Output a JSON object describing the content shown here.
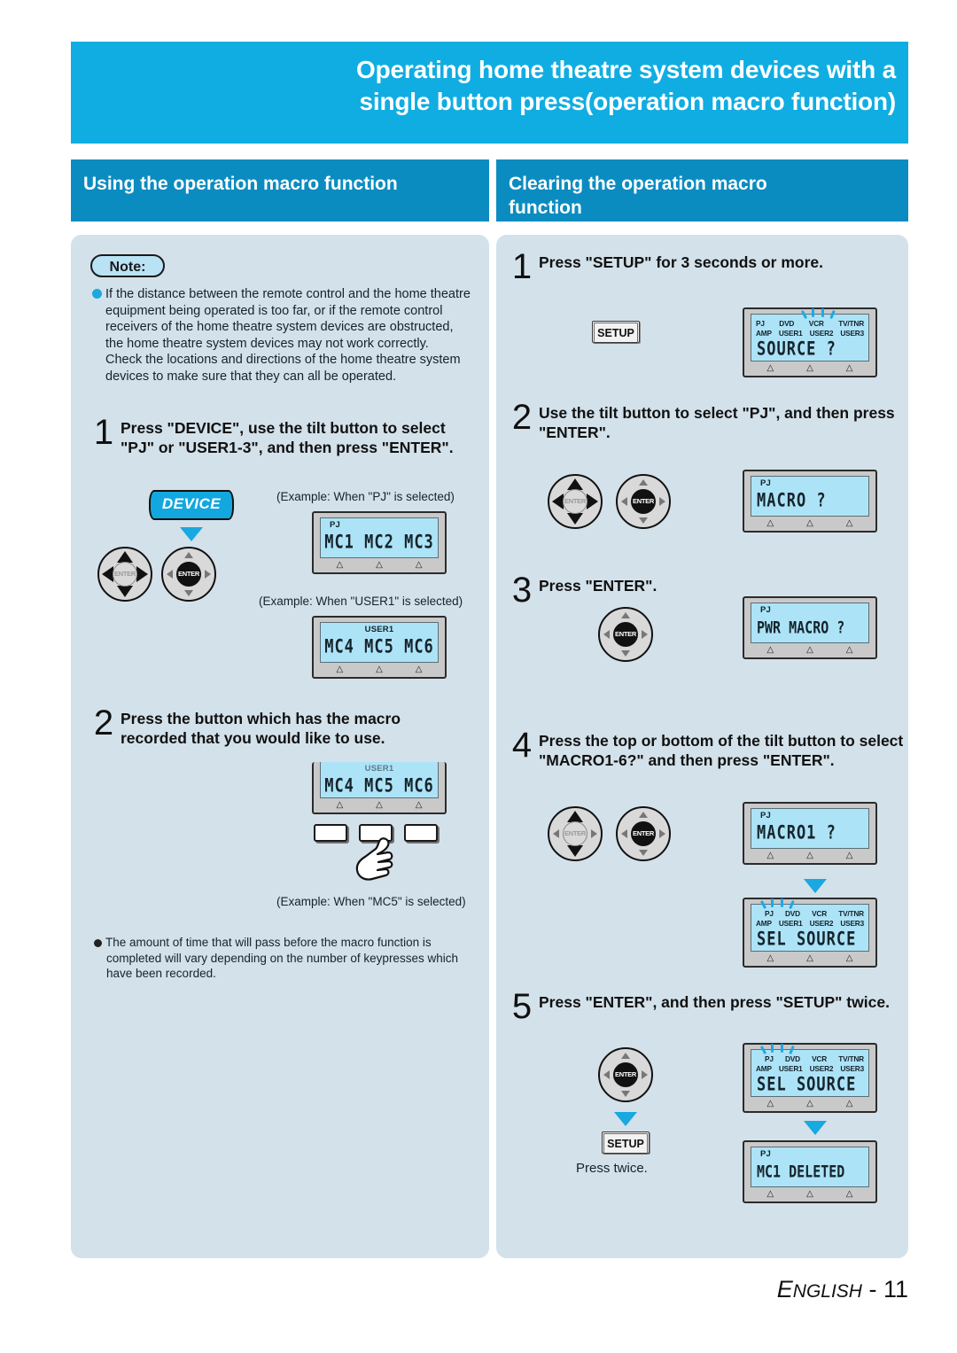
{
  "header": {
    "title_line1": "Operating home theatre system devices with a",
    "title_line2": "single button press(operation macro function)",
    "banner_color": "#10ade2"
  },
  "sections": {
    "left_title": "Using the operation macro function",
    "right_title_line1": "Clearing the operation macro",
    "right_title_line2": "function",
    "bar_color": "#0b8cc0",
    "panel_color": "#d3e1ea"
  },
  "note": {
    "label": "Note:",
    "paragraph1": "If the distance between the remote control and the home theatre equipment being operated is too far, or if the remote control receivers of the home theatre system devices are obstructed, the home theatre system devices may not work correctly.",
    "paragraph2": "Check the locations and directions of the home theatre system devices to make sure that they can all be operated.",
    "bullet_color": "#1fa8dd"
  },
  "left_steps": [
    {
      "num": "1",
      "text": "Press \"DEVICE\", use the tilt button to select \"PJ\" or \"USER1-3\", and then press \"ENTER\".",
      "device_key_label": "DEVICE",
      "caption_pj": "(Example: When \"PJ\" is selected)",
      "caption_user1": "(Example: When \"USER1\" is selected)",
      "lcd_pj": {
        "tag": "PJ",
        "line": "MC1 MC2 MC3"
      },
      "lcd_user1": {
        "tag": "USER1",
        "line": "MC4 MC5 MC6"
      }
    },
    {
      "num": "2",
      "text": "Press the button which has the macro recorded that you would like to use.",
      "lcd": {
        "tag": "USER1",
        "line": "MC4 MC5 MC6"
      },
      "caption_mc5": "(Example: When \"MC5\" is selected)",
      "subnote": "The amount of time that will pass before the macro function is completed will vary depending on the number of keypresses which have been recorded."
    }
  ],
  "right_steps": [
    {
      "num": "1",
      "text": "Press \"SETUP\" for 3 seconds or more.",
      "setup_key_label": "SETUP",
      "lcd": {
        "row1": [
          "PJ",
          "DVD",
          "VCR",
          "TV/TNR"
        ],
        "row2": [
          "AMP",
          "USER1",
          "USER2",
          "USER3"
        ],
        "line": "SOURCE ?"
      }
    },
    {
      "num": "2",
      "text": "Use the tilt button to select \"PJ\", and then press \"ENTER\".",
      "enter_label": "ENTER",
      "lcd": {
        "tag": "PJ",
        "line": "MACRO ?"
      }
    },
    {
      "num": "3",
      "text": "Press \"ENTER\".",
      "enter_label": "ENTER",
      "lcd": {
        "tag": "PJ",
        "line": "PWR MACRO ?"
      }
    },
    {
      "num": "4",
      "text": "Press the top or bottom of the tilt button to select \"MACRO1-6?\" and then press \"ENTER\".",
      "enter_label": "ENTER",
      "lcd_a": {
        "tag": "PJ",
        "line": "MACRO1 ?"
      },
      "lcd_b": {
        "row1": [
          "PJ",
          "DVD",
          "VCR",
          "TV/TNR"
        ],
        "row2": [
          "AMP",
          "USER1",
          "USER2",
          "USER3"
        ],
        "line": "SEL SOURCE"
      }
    },
    {
      "num": "5",
      "text": "Press \"ENTER\", and then press \"SETUP\" twice.",
      "enter_label": "ENTER",
      "setup_key_label": "SETUP",
      "press_twice": "Press twice.",
      "lcd_a": {
        "row1": [
          "PJ",
          "DVD",
          "VCR",
          "TV/TNR"
        ],
        "row2": [
          "AMP",
          "USER1",
          "USER2",
          "USER3"
        ],
        "line": "SEL SOURCE"
      },
      "lcd_b": {
        "tag": "PJ",
        "line": "MC1 DELETED"
      }
    }
  ],
  "lcd_soft_marker": "△",
  "footer": {
    "language_first": "E",
    "language_rest": "NGLISH",
    "separator": " - ",
    "page": "11"
  }
}
